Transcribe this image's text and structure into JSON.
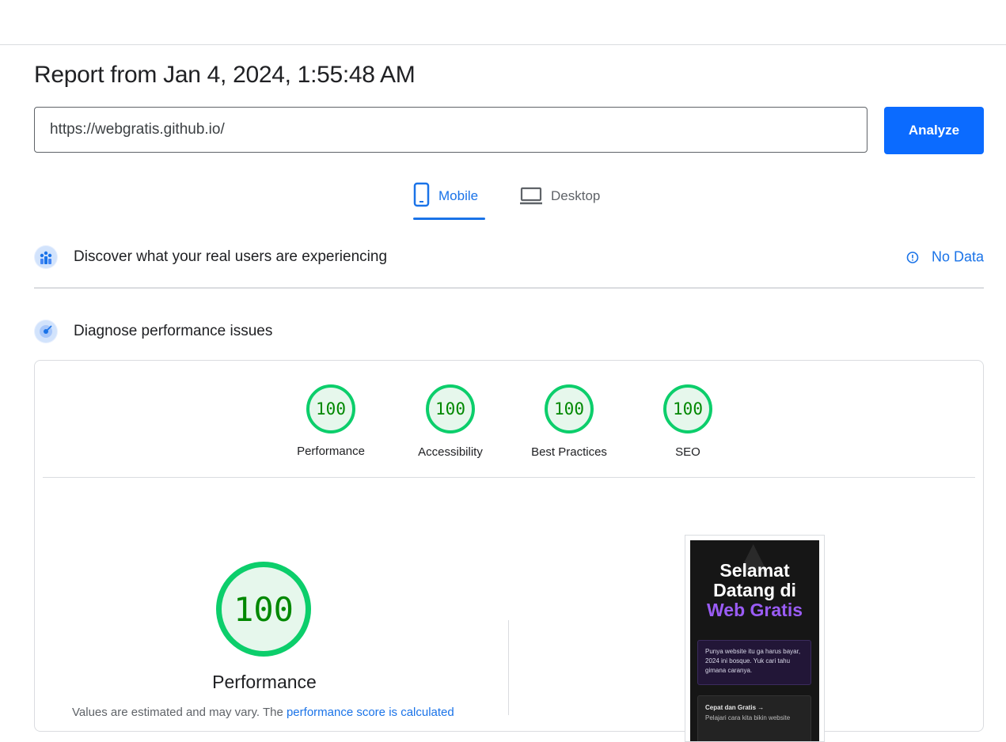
{
  "report": {
    "title": "Report from Jan 4, 2024, 1:55:48 AM"
  },
  "search": {
    "url": "https://webgratis.github.io/",
    "analyze_label": "Analyze"
  },
  "tabs": [
    {
      "label": "Mobile",
      "icon": "smartphone-icon",
      "active": true
    },
    {
      "label": "Desktop",
      "icon": "laptop-icon",
      "active": false
    }
  ],
  "field_data": {
    "heading": "Discover what your real users are experiencing",
    "status": "No Data",
    "icon": "users-chart-icon"
  },
  "lab_data": {
    "heading": "Diagnose performance issues",
    "icon": "radar-icon"
  },
  "scores": [
    {
      "label": "Performance",
      "value": "100"
    },
    {
      "label": "Accessibility",
      "value": "100"
    },
    {
      "label": "Best Practices",
      "value": "100"
    },
    {
      "label": "SEO",
      "value": "100"
    }
  ],
  "performance": {
    "score": "100",
    "label": "Performance",
    "note_prefix": "Values are estimated and may vary. The ",
    "note_link": "performance score is calculated"
  },
  "preview": {
    "title_line1": "Selamat",
    "title_line2": "Datang di",
    "title_line3": "Web Gratis",
    "box1_text": "Punya website itu ga harus bayar, 2024 ini bosque. Yuk cari tahu gimana caranya.",
    "box2_title": "Cepat dan Gratis →",
    "box2_text": "Pelajari cara kita bikin website"
  },
  "colors": {
    "accent": "#1a73e8",
    "primary_button": "#0b6bff",
    "pass": "#0cce6b",
    "pass_text": "#008800"
  }
}
